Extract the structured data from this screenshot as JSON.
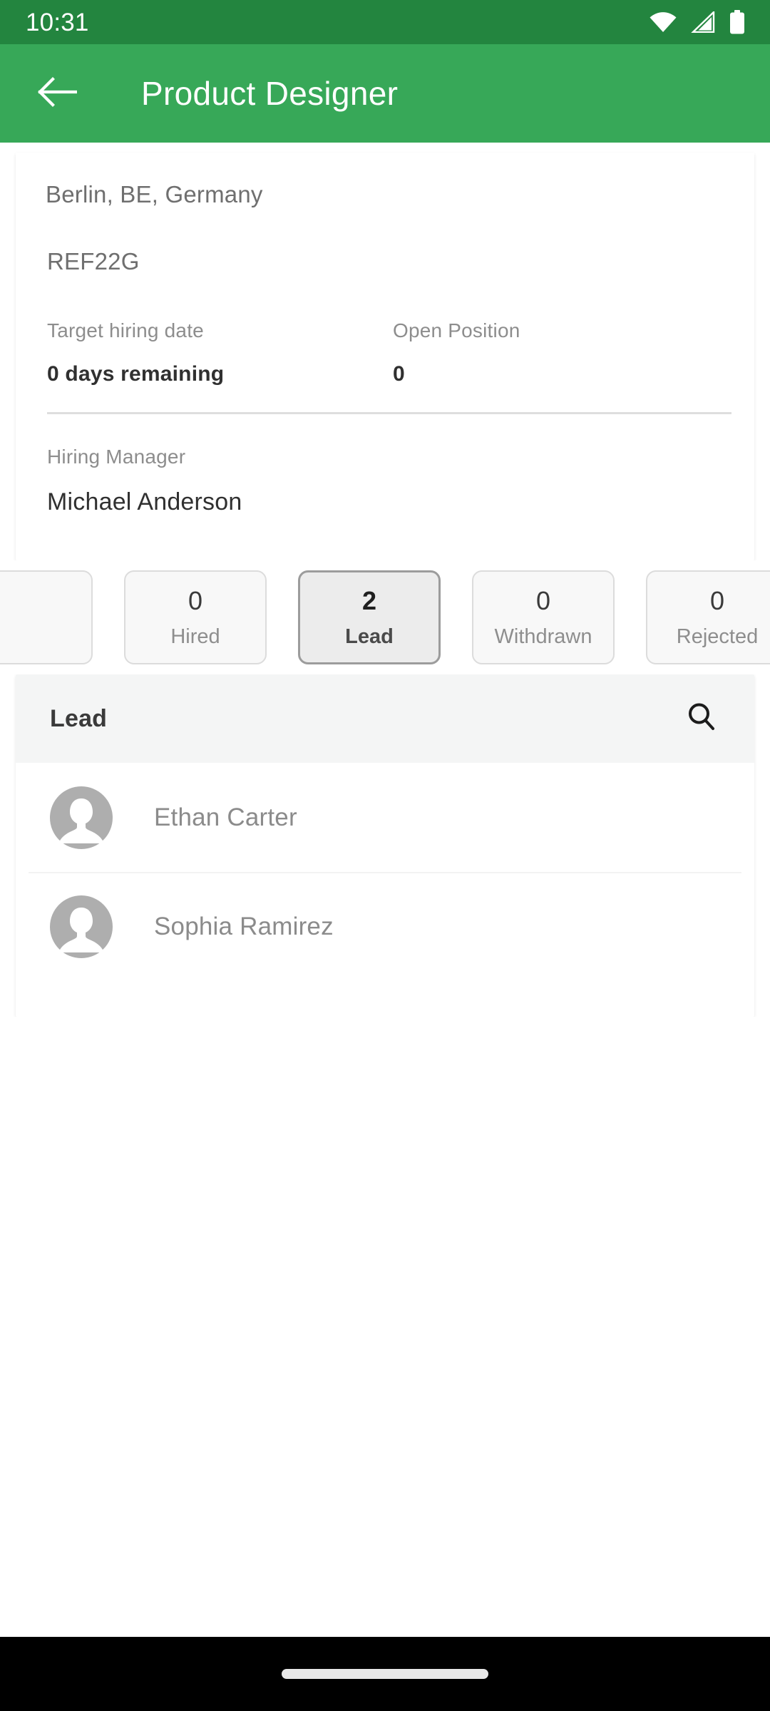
{
  "status_bar": {
    "time": "10:31",
    "icons": [
      "wifi-icon",
      "cellular-signal-icon",
      "battery-icon"
    ],
    "background_color": "#23853F"
  },
  "app_bar": {
    "title": "Product Designer",
    "back_icon": "back-arrow-icon",
    "background_color": "#37A858"
  },
  "job_info": {
    "location": "Berlin, BE, Germany",
    "reference": "REF22G",
    "stats": [
      {
        "label": "Target hiring date",
        "value": "0 days remaining"
      },
      {
        "label": "Open Position",
        "value": "0"
      }
    ],
    "hiring_manager": {
      "label": "Hiring Manager",
      "value": "Michael Anderson"
    }
  },
  "stage_chips": [
    {
      "count": "",
      "label": "",
      "selected": false,
      "partial": true
    },
    {
      "count": "0",
      "label": "Hired",
      "selected": false
    },
    {
      "count": "2",
      "label": "Lead",
      "selected": true
    },
    {
      "count": "0",
      "label": "Withdrawn",
      "selected": false
    },
    {
      "count": "0",
      "label": "Rejected",
      "selected": false
    }
  ],
  "candidate_list": {
    "header_title": "Lead",
    "search_icon": "search-icon",
    "rows": [
      {
        "name": "Ethan Carter",
        "avatar": "person-avatar-icon"
      },
      {
        "name": "Sophia Ramirez",
        "avatar": "person-avatar-icon"
      }
    ]
  },
  "navigation_bar": {
    "home_indicator": "home-indicator-pill"
  }
}
